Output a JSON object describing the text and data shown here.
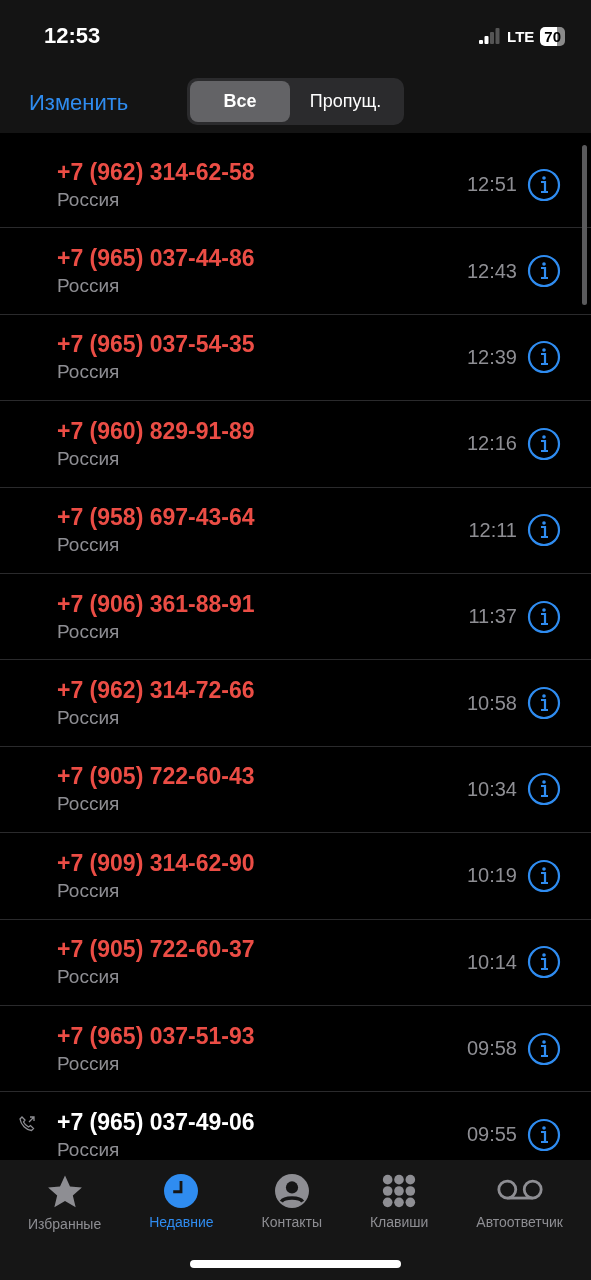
{
  "status_bar": {
    "time": "12:53",
    "network": "LTE",
    "battery": "70"
  },
  "nav": {
    "edit": "Изменить",
    "segments": [
      {
        "label": "Все",
        "selected": true
      },
      {
        "label": "Пропущ.",
        "selected": false
      }
    ]
  },
  "calls": [
    {
      "number": "+7 (962) 314-62-58",
      "location": "Россия",
      "time": "12:51",
      "kind": "missed"
    },
    {
      "number": "+7 (965) 037-44-86",
      "location": "Россия",
      "time": "12:43",
      "kind": "missed"
    },
    {
      "number": "+7 (965) 037-54-35",
      "location": "Россия",
      "time": "12:39",
      "kind": "missed"
    },
    {
      "number": "+7 (960) 829-91-89",
      "location": "Россия",
      "time": "12:16",
      "kind": "missed"
    },
    {
      "number": "+7 (958) 697-43-64",
      "location": "Россия",
      "time": "12:11",
      "kind": "missed"
    },
    {
      "number": "+7 (906) 361-88-91",
      "location": "Россия",
      "time": "11:37",
      "kind": "missed"
    },
    {
      "number": "+7 (962) 314-72-66",
      "location": "Россия",
      "time": "10:58",
      "kind": "missed"
    },
    {
      "number": "+7 (905) 722-60-43",
      "location": "Россия",
      "time": "10:34",
      "kind": "missed"
    },
    {
      "number": "+7 (909) 314-62-90",
      "location": "Россия",
      "time": "10:19",
      "kind": "missed"
    },
    {
      "number": "+7 (905) 722-60-37",
      "location": "Россия",
      "time": "10:14",
      "kind": "missed"
    },
    {
      "number": "+7 (965) 037-51-93",
      "location": "Россия",
      "time": "09:58",
      "kind": "missed"
    },
    {
      "number": "+7 (965) 037-49-06",
      "location": "Россия",
      "time": "09:55",
      "kind": "outgoing"
    }
  ],
  "tab_bar": [
    {
      "label": "Избранные",
      "kind": "favorites",
      "selected": false
    },
    {
      "label": "Недавние",
      "kind": "recents",
      "selected": true
    },
    {
      "label": "Контакты",
      "kind": "contacts",
      "selected": false
    },
    {
      "label": "Клавиши",
      "kind": "keypad",
      "selected": false
    },
    {
      "label": "Автоответчик",
      "kind": "voicemail",
      "selected": false
    }
  ]
}
